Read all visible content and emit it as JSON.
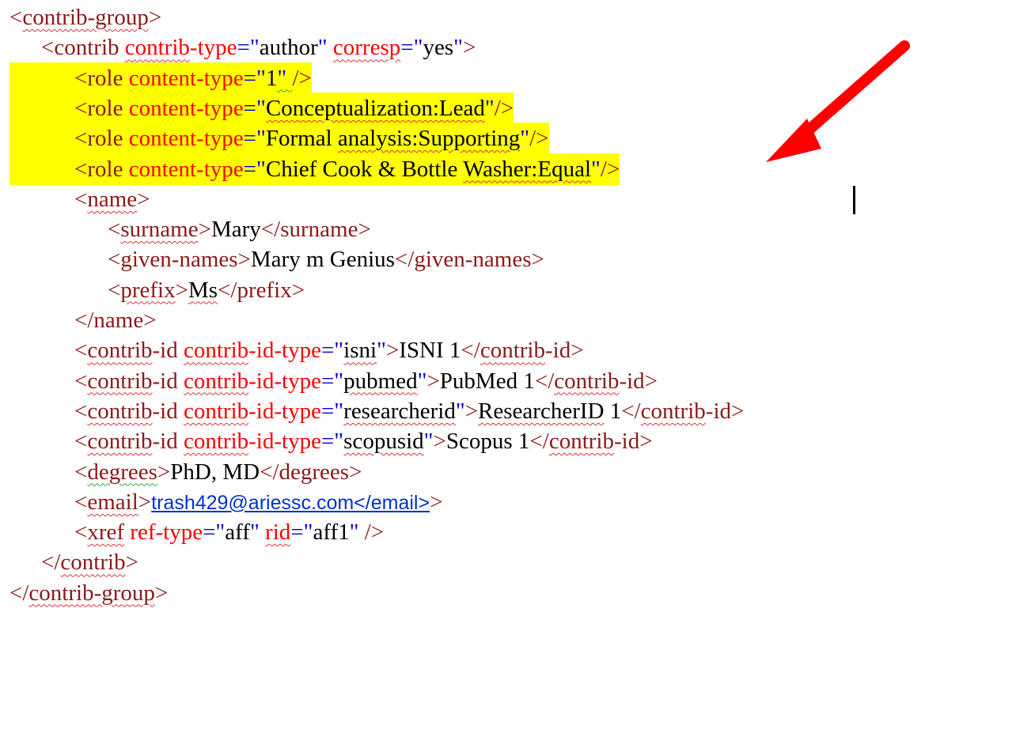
{
  "code": {
    "lines": [
      {
        "indent": 0,
        "highlight": false,
        "parts": [
          {
            "t": "<",
            "c": "t"
          },
          {
            "t": "contrib-group",
            "c": "t",
            "sq": true
          },
          {
            "t": ">",
            "c": "t"
          }
        ]
      },
      {
        "indent": 1,
        "highlight": false,
        "parts": [
          {
            "t": "<contrib ",
            "c": "t"
          },
          {
            "t": "contrib",
            "c": "a",
            "sq": true
          },
          {
            "t": "-type",
            "c": "a"
          },
          {
            "t": "=\"",
            "c": "v"
          },
          {
            "t": "author",
            "c": "x"
          },
          {
            "t": "\" ",
            "c": "v"
          },
          {
            "t": "corresp",
            "c": "a",
            "sq": true
          },
          {
            "t": "=\"",
            "c": "v"
          },
          {
            "t": "yes",
            "c": "x"
          },
          {
            "t": "\"",
            "c": "v"
          },
          {
            "t": ">",
            "c": "t"
          }
        ]
      },
      {
        "indent": 2,
        "highlight": true,
        "parts": [
          {
            "t": "<role ",
            "c": "t"
          },
          {
            "t": "content-type",
            "c": "a"
          },
          {
            "t": "=\"",
            "c": "v"
          },
          {
            "t": "1",
            "c": "x"
          },
          {
            "t": "\" ",
            "c": "v",
            "sqg": true
          },
          {
            "t": "/>",
            "c": "t"
          }
        ]
      },
      {
        "indent": 2,
        "highlight": true,
        "parts": [
          {
            "t": "<role ",
            "c": "t"
          },
          {
            "t": "content-type",
            "c": "a"
          },
          {
            "t": "=\"",
            "c": "v"
          },
          {
            "t": "Conceptualization:Lead",
            "c": "x",
            "sq": true
          },
          {
            "t": "\"",
            "c": "v"
          },
          {
            "t": "/>",
            "c": "t"
          }
        ]
      },
      {
        "indent": 2,
        "highlight": true,
        "parts": [
          {
            "t": "<role ",
            "c": "t"
          },
          {
            "t": "content-type",
            "c": "a"
          },
          {
            "t": "=\"",
            "c": "v"
          },
          {
            "t": "Formal ",
            "c": "x"
          },
          {
            "t": "analysis:Supporting",
            "c": "x",
            "sq": true
          },
          {
            "t": "\"",
            "c": "v"
          },
          {
            "t": "/>",
            "c": "t"
          }
        ]
      },
      {
        "indent": 2,
        "highlight": true,
        "parts": [
          {
            "t": "<role ",
            "c": "t"
          },
          {
            "t": "content-type",
            "c": "a"
          },
          {
            "t": "=\"",
            "c": "v"
          },
          {
            "t": "Chief Cook & Bottle ",
            "c": "x"
          },
          {
            "t": "Washer:Equal",
            "c": "x",
            "sq": true
          },
          {
            "t": "\"",
            "c": "v"
          },
          {
            "t": "/>",
            "c": "t"
          }
        ]
      },
      {
        "indent": 2,
        "highlight": false,
        "parts": [
          {
            "t": "<",
            "c": "t"
          },
          {
            "t": "name",
            "c": "t",
            "sq": true
          },
          {
            "t": ">",
            "c": "t"
          }
        ]
      },
      {
        "indent": 3,
        "highlight": false,
        "parts": [
          {
            "t": "<",
            "c": "t"
          },
          {
            "t": "surname",
            "c": "t",
            "sq": true
          },
          {
            "t": ">",
            "c": "t"
          },
          {
            "t": "Mary",
            "c": "x"
          },
          {
            "t": "</surname>",
            "c": "t"
          }
        ]
      },
      {
        "indent": 3,
        "highlight": false,
        "parts": [
          {
            "t": "<given-names>",
            "c": "t"
          },
          {
            "t": "Mary m Genius",
            "c": "x"
          },
          {
            "t": "</given-names>",
            "c": "t"
          }
        ]
      },
      {
        "indent": 3,
        "highlight": false,
        "parts": [
          {
            "t": "<",
            "c": "t"
          },
          {
            "t": "prefix",
            "c": "t",
            "sq": true
          },
          {
            "t": ">",
            "c": "t"
          },
          {
            "t": "Ms",
            "c": "x",
            "sq": true
          },
          {
            "t": "</prefix>",
            "c": "t"
          }
        ]
      },
      {
        "indent": 2,
        "highlight": false,
        "parts": [
          {
            "t": "</name>",
            "c": "t"
          }
        ]
      },
      {
        "indent": 2,
        "highlight": false,
        "parts": [
          {
            "t": "<",
            "c": "t"
          },
          {
            "t": "contrib",
            "c": "t",
            "sq": true
          },
          {
            "t": "-id ",
            "c": "t"
          },
          {
            "t": "contrib",
            "c": "a",
            "sq": true
          },
          {
            "t": "-id-type",
            "c": "a"
          },
          {
            "t": "=\"",
            "c": "v"
          },
          {
            "t": "isni",
            "c": "x",
            "sq": true
          },
          {
            "t": "\"",
            "c": "v"
          },
          {
            "t": ">",
            "c": "t"
          },
          {
            "t": "ISNI 1",
            "c": "x"
          },
          {
            "t": "</",
            "c": "t"
          },
          {
            "t": "contrib",
            "c": "t",
            "sq": true
          },
          {
            "t": "-id>",
            "c": "t"
          }
        ]
      },
      {
        "indent": 2,
        "highlight": false,
        "parts": [
          {
            "t": "<",
            "c": "t"
          },
          {
            "t": "contrib",
            "c": "t",
            "sq": true
          },
          {
            "t": "-id ",
            "c": "t"
          },
          {
            "t": "contrib",
            "c": "a",
            "sq": true
          },
          {
            "t": "-id-type",
            "c": "a"
          },
          {
            "t": "=\"",
            "c": "v"
          },
          {
            "t": "pubmed",
            "c": "x",
            "sq": true
          },
          {
            "t": "\"",
            "c": "v"
          },
          {
            "t": ">",
            "c": "t"
          },
          {
            "t": "PubMed 1",
            "c": "x"
          },
          {
            "t": "</",
            "c": "t"
          },
          {
            "t": "contrib",
            "c": "t",
            "sq": true
          },
          {
            "t": "-id>",
            "c": "t"
          }
        ]
      },
      {
        "indent": 2,
        "highlight": false,
        "parts": [
          {
            "t": "<",
            "c": "t"
          },
          {
            "t": "contrib",
            "c": "t",
            "sq": true
          },
          {
            "t": "-id ",
            "c": "t"
          },
          {
            "t": "contrib",
            "c": "a",
            "sq": true
          },
          {
            "t": "-id-type",
            "c": "a"
          },
          {
            "t": "=\"",
            "c": "v"
          },
          {
            "t": "researcherid",
            "c": "x",
            "sq": true
          },
          {
            "t": "\"",
            "c": "v"
          },
          {
            "t": ">",
            "c": "t"
          },
          {
            "t": "ResearcherID",
            "c": "x",
            "sq": true
          },
          {
            "t": " 1",
            "c": "x"
          },
          {
            "t": "</",
            "c": "t"
          },
          {
            "t": "contrib",
            "c": "t",
            "sq": true
          },
          {
            "t": "-id>",
            "c": "t"
          }
        ]
      },
      {
        "indent": 2,
        "highlight": false,
        "parts": [
          {
            "t": "<",
            "c": "t"
          },
          {
            "t": "contrib",
            "c": "t",
            "sq": true
          },
          {
            "t": "-id ",
            "c": "t"
          },
          {
            "t": "contrib",
            "c": "a",
            "sq": true
          },
          {
            "t": "-id-type",
            "c": "a"
          },
          {
            "t": "=\"",
            "c": "v"
          },
          {
            "t": "scopusid",
            "c": "x",
            "sq": true
          },
          {
            "t": "\"",
            "c": "v"
          },
          {
            "t": ">",
            "c": "t"
          },
          {
            "t": "Scopus 1",
            "c": "x"
          },
          {
            "t": "</",
            "c": "t"
          },
          {
            "t": "contrib",
            "c": "t",
            "sq": true
          },
          {
            "t": "-id>",
            "c": "t"
          }
        ]
      },
      {
        "indent": 2,
        "highlight": false,
        "parts": [
          {
            "t": "<",
            "c": "t"
          },
          {
            "t": "degrees",
            "c": "t",
            "sqg": true
          },
          {
            "t": ">",
            "c": "t"
          },
          {
            "t": "PhD, MD",
            "c": "x"
          },
          {
            "t": "</degrees>",
            "c": "t"
          }
        ]
      },
      {
        "indent": 2,
        "highlight": false,
        "parts": [
          {
            "t": "<",
            "c": "t"
          },
          {
            "t": "email",
            "c": "t",
            "sq": true
          },
          {
            "t": ">",
            "c": "t"
          },
          {
            "t": "trash429@ariessc.com</email>",
            "c": "link"
          },
          {
            "t": ">",
            "c": "t"
          }
        ]
      },
      {
        "indent": 2,
        "highlight": false,
        "parts": [
          {
            "t": "<",
            "c": "t"
          },
          {
            "t": "xref",
            "c": "t",
            "sq": true
          },
          {
            "t": " ",
            "c": "t"
          },
          {
            "t": "ref-type",
            "c": "a"
          },
          {
            "t": "=\"",
            "c": "v"
          },
          {
            "t": "aff",
            "c": "x"
          },
          {
            "t": "\" ",
            "c": "v"
          },
          {
            "t": "rid",
            "c": "a",
            "sq": true
          },
          {
            "t": "=\"",
            "c": "v"
          },
          {
            "t": "aff1",
            "c": "x"
          },
          {
            "t": "\" ",
            "c": "v"
          },
          {
            "t": "/>",
            "c": "t"
          }
        ]
      },
      {
        "indent": 1,
        "highlight": false,
        "parts": [
          {
            "t": "</",
            "c": "t"
          },
          {
            "t": "contrib",
            "c": "t",
            "sq": true
          },
          {
            "t": ">",
            "c": "t"
          }
        ]
      },
      {
        "indent": 0,
        "highlight": false,
        "parts": [
          {
            "t": "</",
            "c": "t"
          },
          {
            "t": "contrib-group",
            "c": "t",
            "sq": true
          },
          {
            "t": ">",
            "c": "t"
          }
        ]
      }
    ]
  },
  "colors": {
    "highlight": "#ffff00",
    "tag": "#8b1a1a",
    "attribute": "#ff0000",
    "value_quote": "#0000cc",
    "arrow": "#ff0000"
  },
  "annotation": {
    "arrow_icon": "red-arrow-icon"
  }
}
